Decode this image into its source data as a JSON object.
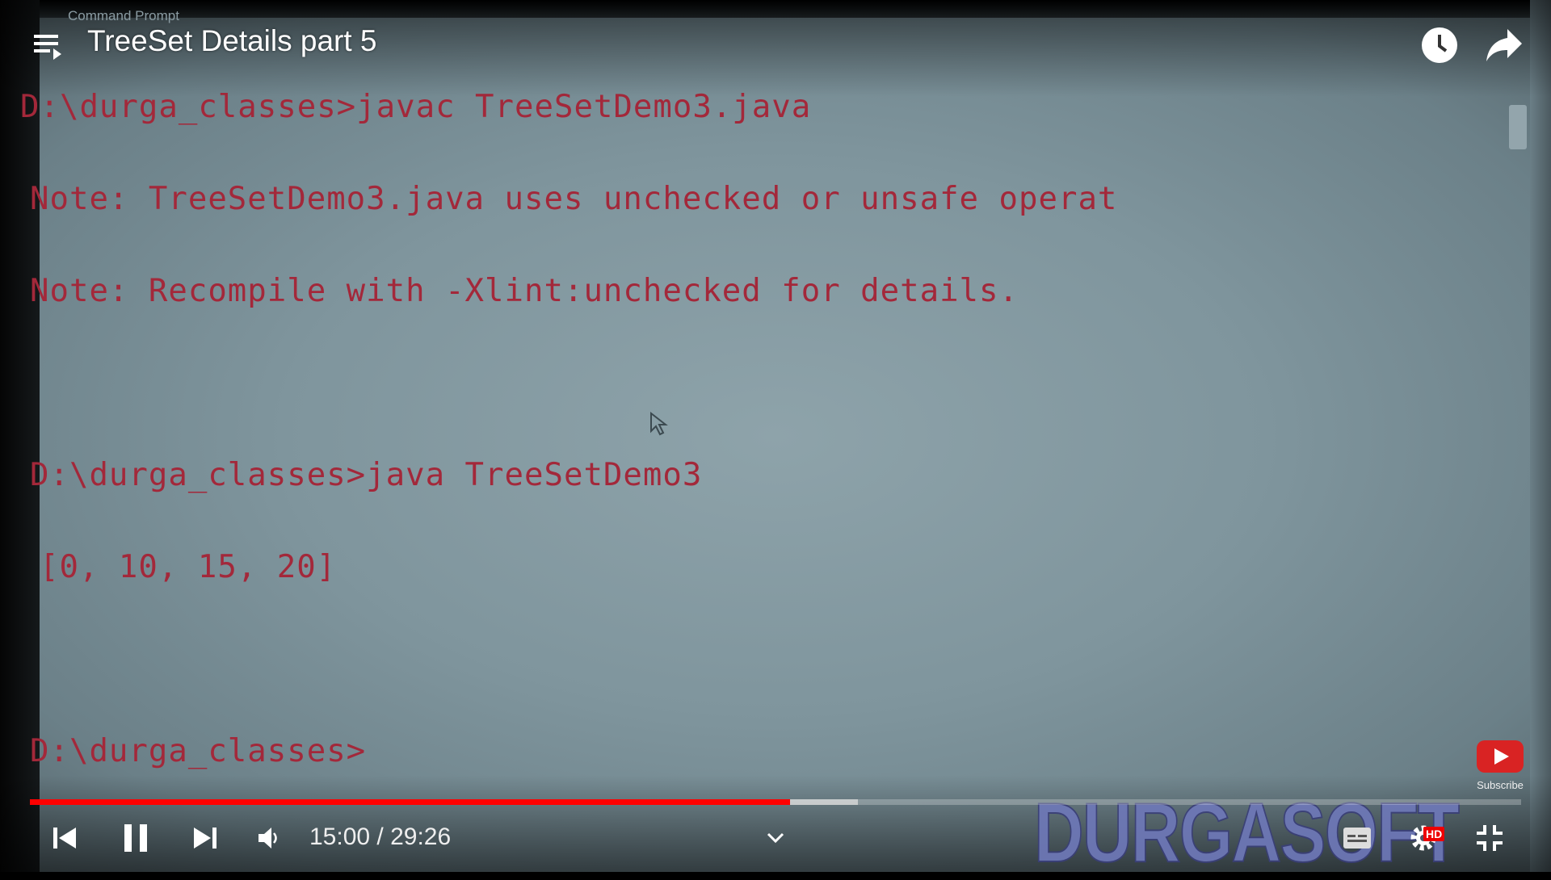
{
  "player": {
    "title": "TreeSet Details part 5",
    "time_current": "15:00",
    "time_separator": " / ",
    "time_total": "29:26",
    "progress_percent": 51,
    "buffered_percent": 55.5,
    "hd_badge": "HD",
    "subscribe_label": "Subscribe",
    "watermark": "DURGASOFT",
    "accent_color": "#ff0000"
  },
  "video_frame": {
    "window_title": "Command Prompt",
    "terminal_lines": [
      "D:\\durga_classes>javac TreeSetDemo3.java",
      "Note: TreeSetDemo3.java uses unchecked or unsafe operat",
      "Note: Recompile with -Xlint:unchecked for details.",
      "",
      "D:\\durga_classes>java TreeSetDemo3",
      "[0, 10, 15, 20]",
      "",
      "D:\\durga_classes>"
    ]
  }
}
